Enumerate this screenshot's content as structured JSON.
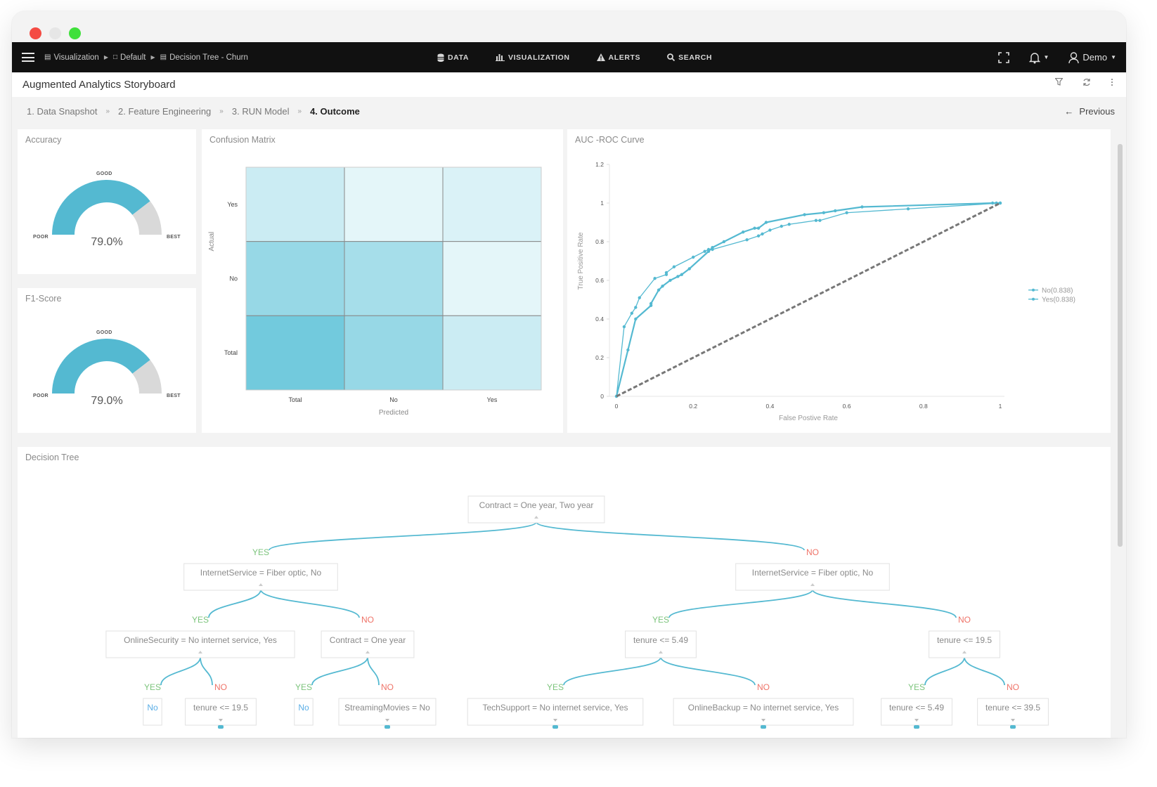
{
  "window": {
    "traffic_lights": [
      {
        "name": "close",
        "color": "#f44b43"
      },
      {
        "name": "minimize",
        "color": "#e6e6e6"
      },
      {
        "name": "maximize",
        "color": "#3fe03b"
      }
    ]
  },
  "navbar": {
    "breadcrumb": [
      {
        "icon": "bar-chart-icon",
        "label": "Visualization"
      },
      {
        "icon": "document-icon",
        "label": "Default"
      },
      {
        "icon": "chart-icon",
        "label": "Decision Tree - Churn"
      }
    ],
    "menu": [
      {
        "icon": "database-icon",
        "label": "DATA"
      },
      {
        "icon": "bar-chart-icon",
        "label": "VISUALIZATION"
      },
      {
        "icon": "alert-icon",
        "label": "ALERTS"
      },
      {
        "icon": "search-icon",
        "label": "SEARCH"
      }
    ],
    "user_label": "Demo"
  },
  "header": {
    "title": "Augmented Analytics Storyboard"
  },
  "steps": {
    "items": [
      {
        "label": "1. Data Snapshot",
        "active": false
      },
      {
        "label": "2. Feature Engineering",
        "active": false
      },
      {
        "label": "3. RUN Model",
        "active": false
      },
      {
        "label": "4. Outcome",
        "active": true
      }
    ],
    "previous_label": "Previous"
  },
  "accent_color": "#54b9d1",
  "gauges": [
    {
      "title": "Accuracy",
      "value": 0.79,
      "value_label": "79.0%",
      "labels": {
        "poor": "POOR",
        "good": "GOOD",
        "best": "BEST"
      }
    },
    {
      "title": "F1-Score",
      "value": 0.79,
      "value_label": "79.0%",
      "labels": {
        "poor": "POOR",
        "good": "GOOD",
        "best": "BEST"
      }
    }
  ],
  "chart_data": [
    {
      "type": "heatmap",
      "title": "Confusion Matrix",
      "xlabel": "Predicted",
      "ylabel": "Actual",
      "x_categories": [
        "Total",
        "No",
        "Yes"
      ],
      "y_categories": [
        "Yes",
        "No",
        "Total"
      ],
      "intensity": [
        [
          0.25,
          0.08,
          0.15
        ],
        [
          0.6,
          0.5,
          0.08
        ],
        [
          0.85,
          0.6,
          0.25
        ]
      ]
    },
    {
      "type": "line",
      "title": "AUC -ROC Curve",
      "xlabel": "False Postive Rate",
      "ylabel": "True Positive Rate",
      "xlim": [
        0,
        1
      ],
      "ylim": [
        0,
        1.2
      ],
      "x_ticks": [
        "0",
        "0.2",
        "0.4",
        "0.6",
        "0.8",
        "1"
      ],
      "y_ticks": [
        "0",
        "0.2",
        "0.4",
        "0.6",
        "0.8",
        "1",
        "1.2"
      ],
      "legend_position": "right",
      "series": [
        {
          "name": "No(0.838)",
          "points": [
            [
              0,
              0
            ],
            [
              0.02,
              0.36
            ],
            [
              0.04,
              0.43
            ],
            [
              0.05,
              0.46
            ],
            [
              0.06,
              0.51
            ],
            [
              0.1,
              0.61
            ],
            [
              0.13,
              0.63
            ],
            [
              0.13,
              0.64
            ],
            [
              0.15,
              0.67
            ],
            [
              0.2,
              0.72
            ],
            [
              0.23,
              0.75
            ],
            [
              0.24,
              0.76
            ],
            [
              0.25,
              0.76
            ],
            [
              0.34,
              0.81
            ],
            [
              0.37,
              0.83
            ],
            [
              0.38,
              0.84
            ],
            [
              0.4,
              0.86
            ],
            [
              0.43,
              0.88
            ],
            [
              0.45,
              0.89
            ],
            [
              0.52,
              0.91
            ],
            [
              0.53,
              0.91
            ],
            [
              0.6,
              0.95
            ],
            [
              0.76,
              0.97
            ],
            [
              1,
              1
            ]
          ]
        },
        {
          "name": "Yes(0.838)",
          "points": [
            [
              0,
              0
            ],
            [
              0.03,
              0.24
            ],
            [
              0.05,
              0.4
            ],
            [
              0.09,
              0.47
            ],
            [
              0.09,
              0.48
            ],
            [
              0.11,
              0.55
            ],
            [
              0.12,
              0.57
            ],
            [
              0.14,
              0.6
            ],
            [
              0.16,
              0.62
            ],
            [
              0.17,
              0.63
            ],
            [
              0.19,
              0.66
            ],
            [
              0.24,
              0.75
            ],
            [
              0.25,
              0.77
            ],
            [
              0.28,
              0.8
            ],
            [
              0.33,
              0.85
            ],
            [
              0.36,
              0.87
            ],
            [
              0.37,
              0.87
            ],
            [
              0.39,
              0.9
            ],
            [
              0.49,
              0.94
            ],
            [
              0.54,
              0.95
            ],
            [
              0.57,
              0.96
            ],
            [
              0.64,
              0.98
            ],
            [
              0.98,
              1
            ],
            [
              0.99,
              1
            ],
            [
              1,
              1
            ]
          ]
        },
        {
          "name": "baseline",
          "dashed": true,
          "points": [
            [
              0,
              0
            ],
            [
              1,
              1
            ]
          ]
        }
      ]
    }
  ],
  "decision_tree": {
    "title": "Decision Tree",
    "yes_label": "YES",
    "no_label": "NO",
    "nodes": [
      {
        "id": "root",
        "label": "Contract = One year, Two year",
        "parent": null
      },
      {
        "id": "l",
        "label": "InternetService = Fiber optic, No",
        "parent": "root",
        "branch": "YES"
      },
      {
        "id": "r",
        "label": "InternetService = Fiber optic, No",
        "parent": "root",
        "branch": "NO"
      },
      {
        "id": "ll",
        "label": "OnlineSecurity = No internet service, Yes",
        "parent": "l",
        "branch": "YES"
      },
      {
        "id": "lr",
        "label": "Contract = One year",
        "parent": "l",
        "branch": "NO"
      },
      {
        "id": "rl",
        "label": "tenure <= 5.49",
        "parent": "r",
        "branch": "YES"
      },
      {
        "id": "rr",
        "label": "tenure <= 19.5",
        "parent": "r",
        "branch": "NO"
      },
      {
        "id": "lll",
        "label": "No",
        "parent": "ll",
        "branch": "YES",
        "leaf": true
      },
      {
        "id": "llr",
        "label": "tenure <= 19.5",
        "parent": "ll",
        "branch": "NO"
      },
      {
        "id": "lrl",
        "label": "No",
        "parent": "lr",
        "branch": "YES",
        "leaf": true
      },
      {
        "id": "lrr",
        "label": "StreamingMovies = No",
        "parent": "lr",
        "branch": "NO"
      },
      {
        "id": "rll",
        "label": "TechSupport = No internet service, Yes",
        "parent": "rl",
        "branch": "YES"
      },
      {
        "id": "rlr",
        "label": "OnlineBackup = No internet service, Yes",
        "parent": "rl",
        "branch": "NO"
      },
      {
        "id": "rrl",
        "label": "tenure <= 5.49",
        "parent": "rr",
        "branch": "YES"
      },
      {
        "id": "rrr",
        "label": "tenure <= 39.5",
        "parent": "rr",
        "branch": "NO"
      }
    ]
  }
}
